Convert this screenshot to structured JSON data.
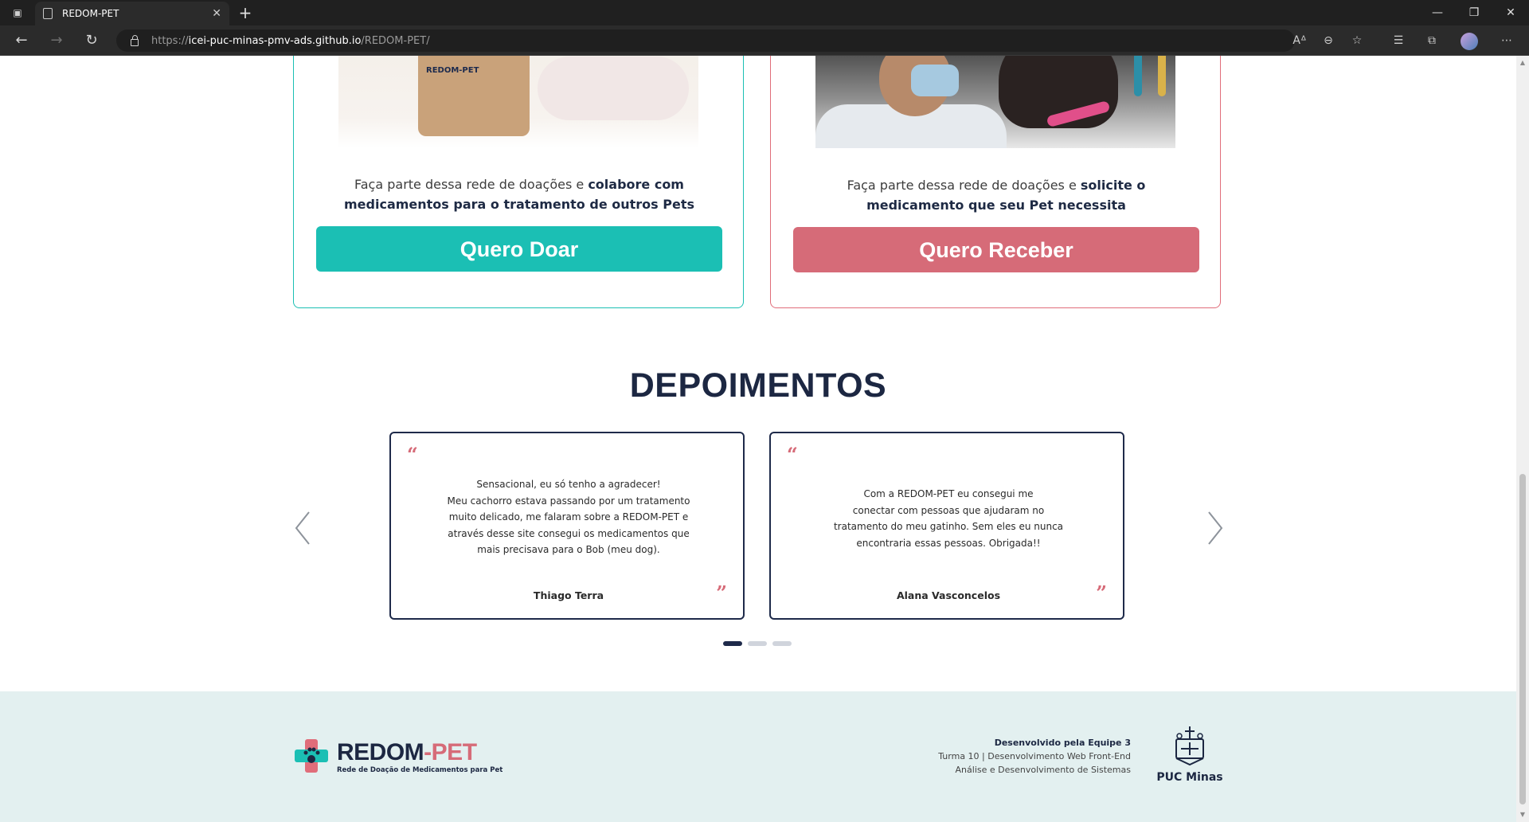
{
  "browser": {
    "tab_title": "REDOM-PET",
    "url_scheme": "https://",
    "url_host": "icei-puc-minas-pmv-ads.github.io",
    "url_path": "/REDOM-PET/"
  },
  "cards": {
    "donate": {
      "text_normal": "Faça parte dessa rede de doações e ",
      "text_bold_1": "colabore com",
      "text_bold_2": "medicamentos para o tratamento de outros Pets",
      "button_label": "Quero Doar",
      "bag_logo": "REDOM-PET"
    },
    "receive": {
      "text_normal": "Faça parte dessa rede de doações e ",
      "text_bold_1": "solicite o",
      "text_bold_2": "medicamento que seu Pet necessita",
      "button_label": "Quero Receber"
    }
  },
  "testimonials": {
    "title": "DEPOIMENTOS",
    "items": [
      {
        "lines": [
          "Sensacional, eu só tenho a agradecer!",
          "Meu cachorro estava passando por um tratamento",
          "muito delicado, me falaram sobre a REDOM-PET e",
          "através desse site consegui os medicamentos que",
          "mais precisava para o Bob (meu dog)."
        ],
        "author": "Thiago Terra"
      },
      {
        "lines": [
          "Com a REDOM-PET eu consegui me",
          "conectar com pessoas que  ajudaram no",
          "tratamento do meu gatinho. Sem eles eu nunca",
          "encontraria essas pessoas. Obrigada!!"
        ],
        "author": "Alana Vasconcelos"
      }
    ],
    "quote_open": "“",
    "quote_close": "”",
    "carousel_active_index": 0,
    "carousel_count": 3
  },
  "footer": {
    "brand_part1": "REDOM",
    "brand_dash": "-",
    "brand_part2": "PET",
    "tagline": "Rede de Doação de Medicamentos para Pet",
    "developed_by": "Desenvolvido pela Equipe 3",
    "course_line": "Turma 10 | Desenvolvimento Web Front-End",
    "program_line": "Análise e Desenvolvimento de Sistemas",
    "university": "PUC Minas"
  },
  "colors": {
    "teal": "#1bbfb4",
    "pink": "#d66b78",
    "navy": "#1c2742",
    "footer_bg": "#e3f0f0"
  }
}
